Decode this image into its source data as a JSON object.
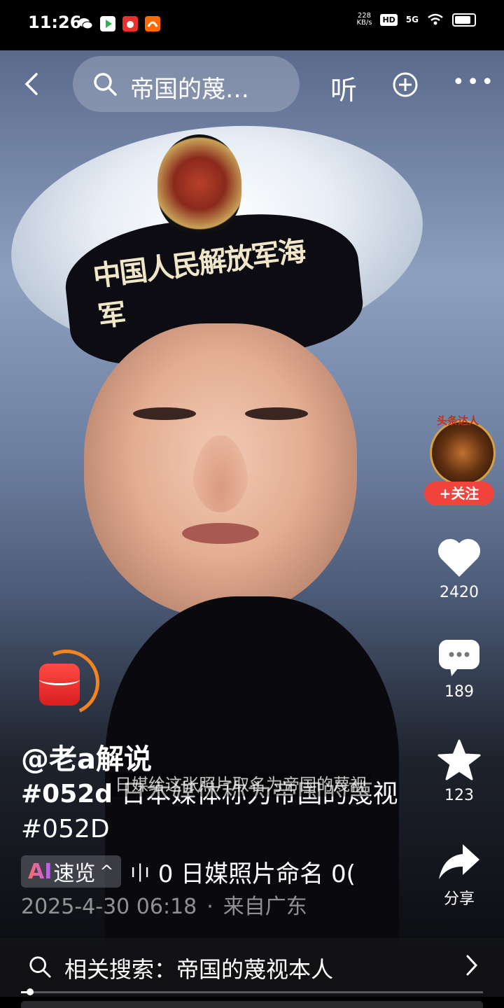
{
  "status_bar": {
    "time": "11:26",
    "net_speed_value": "228",
    "net_speed_unit": "KB/s",
    "hd": "HD",
    "signal": "5G"
  },
  "top_bar": {
    "search_text": "帝国的蔑…",
    "listen_label": "听"
  },
  "video": {
    "cap_text": "中国人民解放军海军"
  },
  "side_actions": {
    "avatar_tag": "头条达人",
    "follow_label": "+关注",
    "likes": "2420",
    "comments": "189",
    "favorites": "123",
    "share_label": "分享"
  },
  "post": {
    "author": "@老a解说",
    "hashtag1": "#052d",
    "description": " 日本媒体称为帝国的蔑视",
    "hashtag2": "#052D",
    "subtitle": "日媒给这张照片取名为帝国的蔑视",
    "ai_logo": "AI",
    "ai_label": "速览",
    "ai_chevron": "^",
    "ticker_text": "0 日媒照片命名    0(",
    "date": "2025-4-30 06:18",
    "location": "来自广东"
  },
  "related_search": {
    "label": "相关搜索：帝国的蔑视本人"
  },
  "playback": {
    "progress": 0.02
  },
  "colors": {
    "follow": "#f0443c",
    "redpack": "#e8322e",
    "ring": "#f5841f"
  }
}
